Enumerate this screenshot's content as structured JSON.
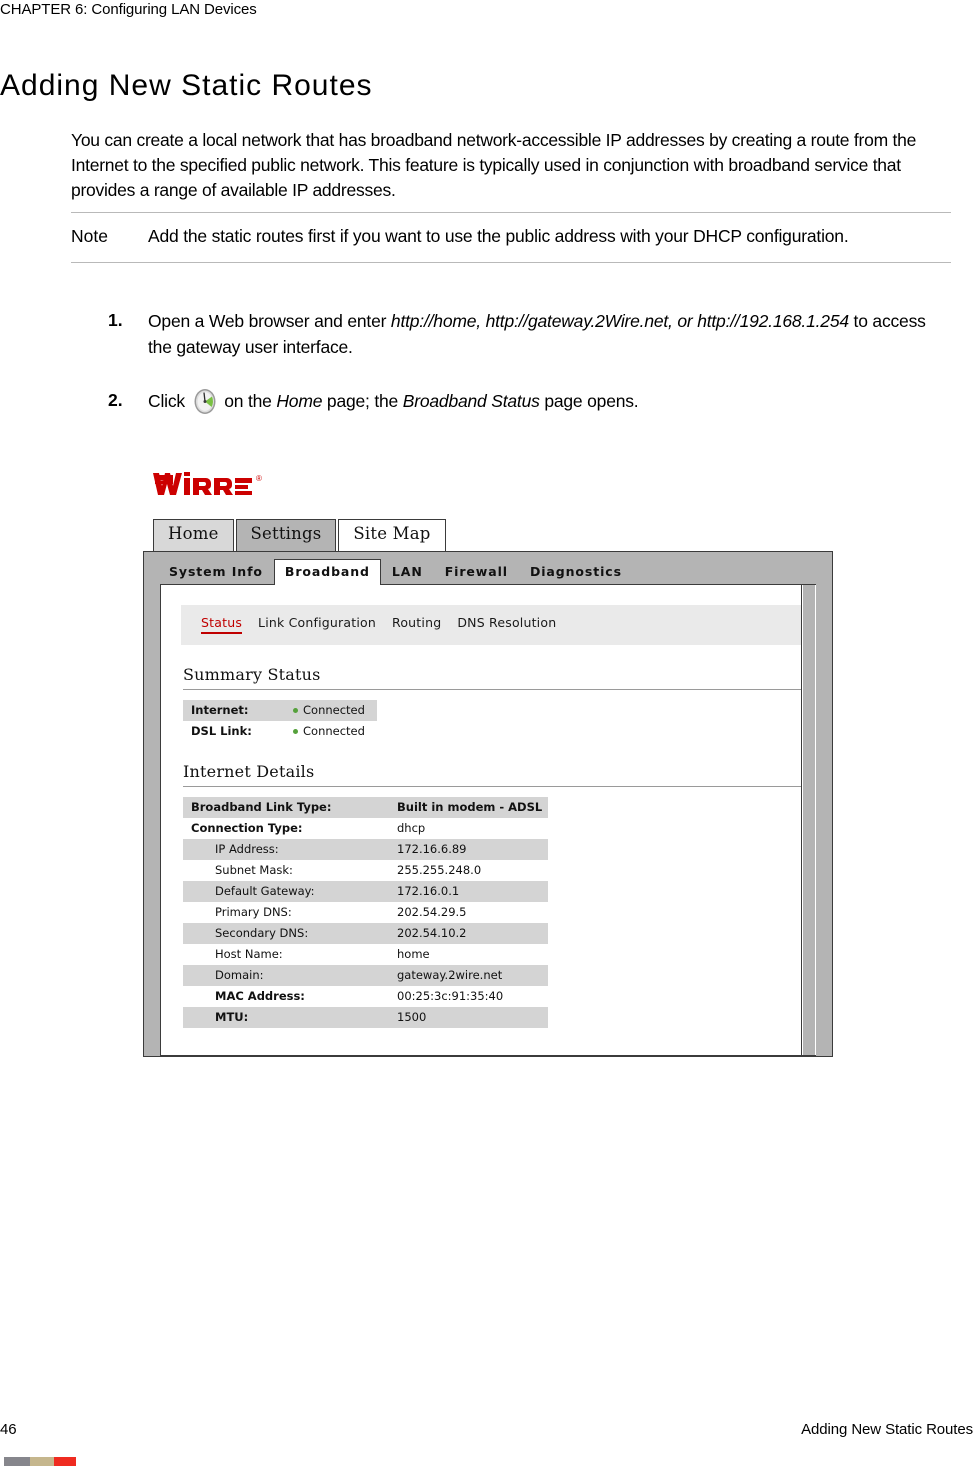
{
  "running_head": "CHAPTER 6: Configuring LAN Devices",
  "page_title": "Adding New Static Routes",
  "intro_paragraph": "You can create a local network that has broadband network-accessible IP addresses by creating a route from the Internet to the specified public network. This feature is typically used in conjunction with broadband service that provides a range of available IP addresses.",
  "note": {
    "label": "Note",
    "text": "Add the static routes first if you want to use the public address with your DHCP configuration."
  },
  "steps": [
    {
      "number": "1.",
      "pre": "Open a Web browser and enter ",
      "italic_1": "http://home, http://gateway.2Wire.net, or http://192.168.1.254",
      "post": " to access the gateway user interface."
    },
    {
      "number": "2.",
      "pre": "Click ",
      "icon": "gauge-icon",
      "mid": " on the ",
      "italic_1": "Home",
      "mid2": " page; the ",
      "italic_2": "Broadband Status",
      "post": " page opens."
    }
  ],
  "figure": {
    "logo_text": "2WIRE",
    "logo_mark": "®",
    "logo_color": "#cc0000",
    "top_tabs": [
      {
        "label": "Home",
        "state": "inactive"
      },
      {
        "label": "Settings",
        "state": "inactive-dark"
      },
      {
        "label": "Site Map",
        "state": "active"
      }
    ],
    "nav_tabs": [
      {
        "label": "System Info",
        "active": false
      },
      {
        "label": "Broadband",
        "active": true
      },
      {
        "label": "LAN",
        "active": false
      },
      {
        "label": "Firewall",
        "active": false
      },
      {
        "label": "Diagnostics",
        "active": false
      }
    ],
    "sub_nav": [
      {
        "label": "Status",
        "active": true
      },
      {
        "label": "Link Configuration",
        "active": false
      },
      {
        "label": "Routing",
        "active": false
      },
      {
        "label": "DNS Resolution",
        "active": false
      }
    ],
    "active_link_color": "#c00000",
    "summary_status": {
      "title": "Summary Status",
      "rows": [
        {
          "key": "Internet:",
          "value": "Connected",
          "dot": true,
          "shaded": true,
          "bold_key": true
        },
        {
          "key": "DSL Link:",
          "value": "Connected",
          "dot": true,
          "shaded": false,
          "bold_key": true
        }
      ],
      "status_dot_color": "#55a13b"
    },
    "internet_details": {
      "title": "Internet Details",
      "rows": [
        {
          "key": "Broadband Link Type:",
          "value": "Built in modem - ADSL",
          "shaded": true,
          "bold_key": true,
          "bold_value": true,
          "indent": false
        },
        {
          "key": "Connection Type:",
          "value": "dhcp",
          "shaded": false,
          "bold_key": true,
          "bold_value": false,
          "indent": false
        },
        {
          "key": "IP Address:",
          "value": "172.16.6.89",
          "shaded": true,
          "bold_key": false,
          "bold_value": false,
          "indent": true
        },
        {
          "key": "Subnet Mask:",
          "value": "255.255.248.0",
          "shaded": false,
          "bold_key": false,
          "bold_value": false,
          "indent": true
        },
        {
          "key": "Default Gateway:",
          "value": "172.16.0.1",
          "shaded": true,
          "bold_key": false,
          "bold_value": false,
          "indent": true
        },
        {
          "key": "Primary DNS:",
          "value": "202.54.29.5",
          "shaded": false,
          "bold_key": false,
          "bold_value": false,
          "indent": true
        },
        {
          "key": "Secondary DNS:",
          "value": "202.54.10.2",
          "shaded": true,
          "bold_key": false,
          "bold_value": false,
          "indent": true
        },
        {
          "key": "Host Name:",
          "value": "home",
          "shaded": false,
          "bold_key": false,
          "bold_value": false,
          "indent": true
        },
        {
          "key": "Domain:",
          "value": "gateway.2wire.net",
          "shaded": true,
          "bold_key": false,
          "bold_value": false,
          "indent": true
        },
        {
          "key": "MAC Address:",
          "value": "00:25:3c:91:35:40",
          "shaded": false,
          "bold_key": true,
          "bold_value": false,
          "indent": true
        },
        {
          "key": "MTU:",
          "value": "1500",
          "shaded": true,
          "bold_key": true,
          "bold_value": false,
          "indent": true
        }
      ]
    }
  },
  "footer": {
    "page_number": "46",
    "section_name": "Adding New Static Routes",
    "color_bar": [
      "#86868c",
      "#c5b68d",
      "#ef2b20"
    ]
  }
}
